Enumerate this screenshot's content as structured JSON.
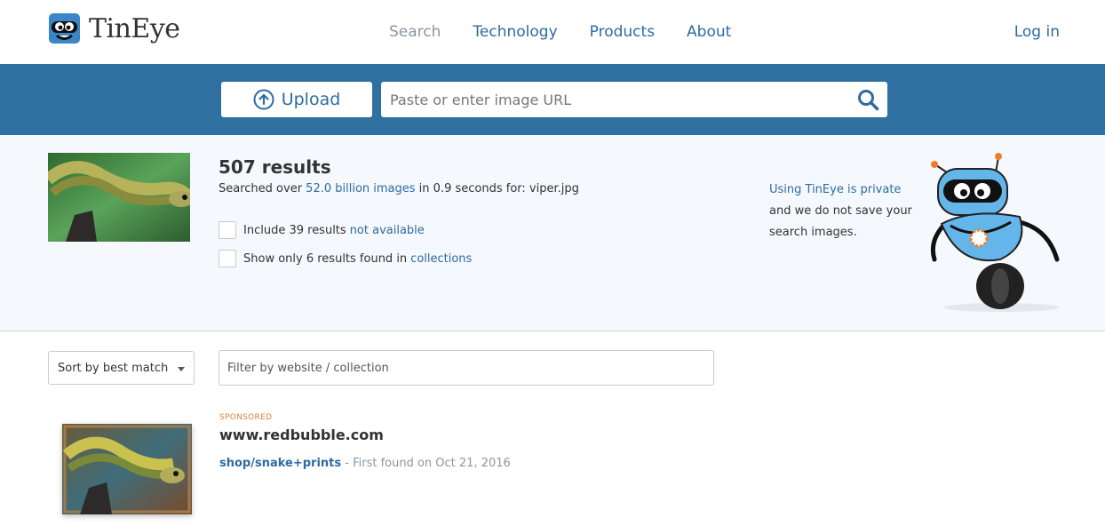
{
  "header": {
    "logo_text": "TinEye",
    "nav": [
      "Search",
      "Technology",
      "Products",
      "About"
    ],
    "login": "Log in"
  },
  "search": {
    "upload_label": "Upload",
    "url_placeholder": "Paste or enter image URL"
  },
  "summary": {
    "count": "507 results",
    "meta_prefix": "Searched over ",
    "meta_link": "52.0 billion images",
    "meta_suffix": " in 0.9 seconds for: ",
    "filename": "viper.jpg",
    "option1_text": "Include 39 results",
    "option1_link": "not available",
    "option2_text": "Show only 6 results found in",
    "option2_link": "collections",
    "privacy_link": "Using TinEye is private",
    "privacy_line2": "and we do not save your",
    "privacy_line3": "search images."
  },
  "filters": {
    "sort_label": "Sort by best match",
    "filter_placeholder": "Filter by website / collection"
  },
  "result": {
    "sponsored": "SPONSORED",
    "domain": "www.redbubble.com",
    "path": "shop/snake+prints",
    "found": " - First found on Oct 21, 2016"
  },
  "colors": {
    "brand_blue": "#2f70a0",
    "link_blue": "#2d6ba1",
    "sponsored_orange": "#e0813a"
  }
}
